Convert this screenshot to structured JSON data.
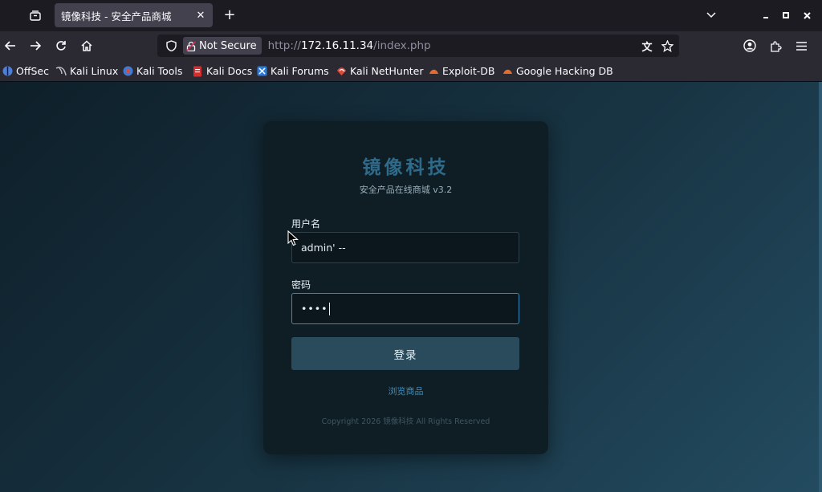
{
  "browser": {
    "tab": {
      "title": "镜像科技 - 安全产品商城"
    },
    "url": {
      "protocol": "http://",
      "host": "172.16.11.34",
      "path": "/index.php"
    },
    "security_label": "Not Secure",
    "bookmarks": [
      {
        "label": "OffSec",
        "icon": "offsec-icon",
        "color": "#4e7fd6"
      },
      {
        "label": "Kali Linux",
        "icon": "kali-dragon-icon",
        "color": "#bfc3c9"
      },
      {
        "label": "Kali Tools",
        "icon": "kali-tools-icon",
        "color": "#3c7cd6"
      },
      {
        "label": "Kali Docs",
        "icon": "kali-docs-icon",
        "color": "#d32f2f"
      },
      {
        "label": "Kali Forums",
        "icon": "kali-forums-icon",
        "color": "#2f7ad6"
      },
      {
        "label": "Kali NetHunter",
        "icon": "nethunter-icon",
        "color": "#e04a3a"
      },
      {
        "label": "Exploit-DB",
        "icon": "exploit-db-icon",
        "color": "#e66a2a"
      },
      {
        "label": "Google Hacking DB",
        "icon": "ghdb-icon",
        "color": "#e66a2a"
      }
    ]
  },
  "page": {
    "brand": "镜像科技",
    "subtitle": "安全产品在线商城 v3.2",
    "username_label": "用户名",
    "username_value": "admin' --",
    "password_label": "密码",
    "password_mask": "••••",
    "login_button": "登录",
    "browse_link": "浏览商品",
    "copyright": "Copyright 2026 镜像科技 All Rights Reserved",
    "accent_color": "#3d8fbf"
  }
}
